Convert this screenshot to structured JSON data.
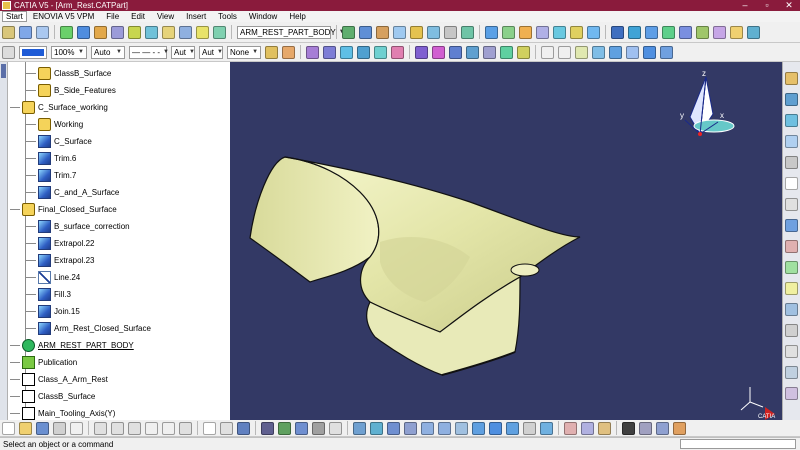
{
  "window": {
    "title": "CATIA V5 - [Arm_Rest.CATPart]",
    "controls": {
      "minimize": "–",
      "maximize": "▫",
      "close": "✕"
    }
  },
  "menu": [
    "Start",
    "ENOVIA V5 VPM",
    "File",
    "Edit",
    "View",
    "Insert",
    "Tools",
    "Window",
    "Help"
  ],
  "toolbar1": {
    "part_body_select": "ARM_REST_PART_BODY"
  },
  "toolbar2": {
    "color_swatch": "#1e5bd6",
    "opacity": "100%",
    "line_thickness": "Auto",
    "line_type": "— — - -",
    "point_symbol": "Aut",
    "layer_placeholder": "Aut",
    "layer": "None"
  },
  "tree": {
    "items": [
      {
        "label": "ClassB_Surface",
        "icon": "geometric-set-icon"
      },
      {
        "label": "B_Side_Features",
        "icon": "geometric-set-icon"
      },
      {
        "label": "C_Surface_working",
        "icon": "geometric-set-icon"
      },
      {
        "label": "Working",
        "icon": "geometric-set-icon"
      },
      {
        "label": "C_Surface",
        "icon": "surface-icon"
      },
      {
        "label": "Trim.6",
        "icon": "trim-icon"
      },
      {
        "label": "Trim.7",
        "icon": "trim-icon"
      },
      {
        "label": "C_and_A_Surface",
        "icon": "surface-icon"
      },
      {
        "label": "Final_Closed_Surface",
        "icon": "geometric-set-icon"
      },
      {
        "label": "B_surface_correction",
        "icon": "surface-icon"
      },
      {
        "label": "Extrapol.22",
        "icon": "extrapolate-icon"
      },
      {
        "label": "Extrapol.23",
        "icon": "extrapolate-icon"
      },
      {
        "label": "Line.24",
        "icon": "line-icon"
      },
      {
        "label": "Fill.3",
        "icon": "fill-icon"
      },
      {
        "label": "Join.15",
        "icon": "join-icon"
      },
      {
        "label": "Arm_Rest_Closed_Surface",
        "icon": "surface-icon"
      },
      {
        "label": "ARM_REST_PART_BODY",
        "icon": "body-icon"
      },
      {
        "label": "Publication",
        "icon": "publication-icon"
      },
      {
        "label": "Class_A_Arm_Rest",
        "icon": "published-element-icon"
      },
      {
        "label": "ClassB_Surface",
        "icon": "published-element-icon"
      },
      {
        "label": "Main_Tooling_Axis(Y)",
        "icon": "published-element-icon"
      }
    ]
  },
  "viewport": {
    "background": "#333965",
    "part_color": "#e6e8b0",
    "compass_labels": {
      "x": "x",
      "y": "y",
      "z": "z"
    },
    "logo_text": "CATIA"
  },
  "status": {
    "message": "Select an object or a command"
  }
}
